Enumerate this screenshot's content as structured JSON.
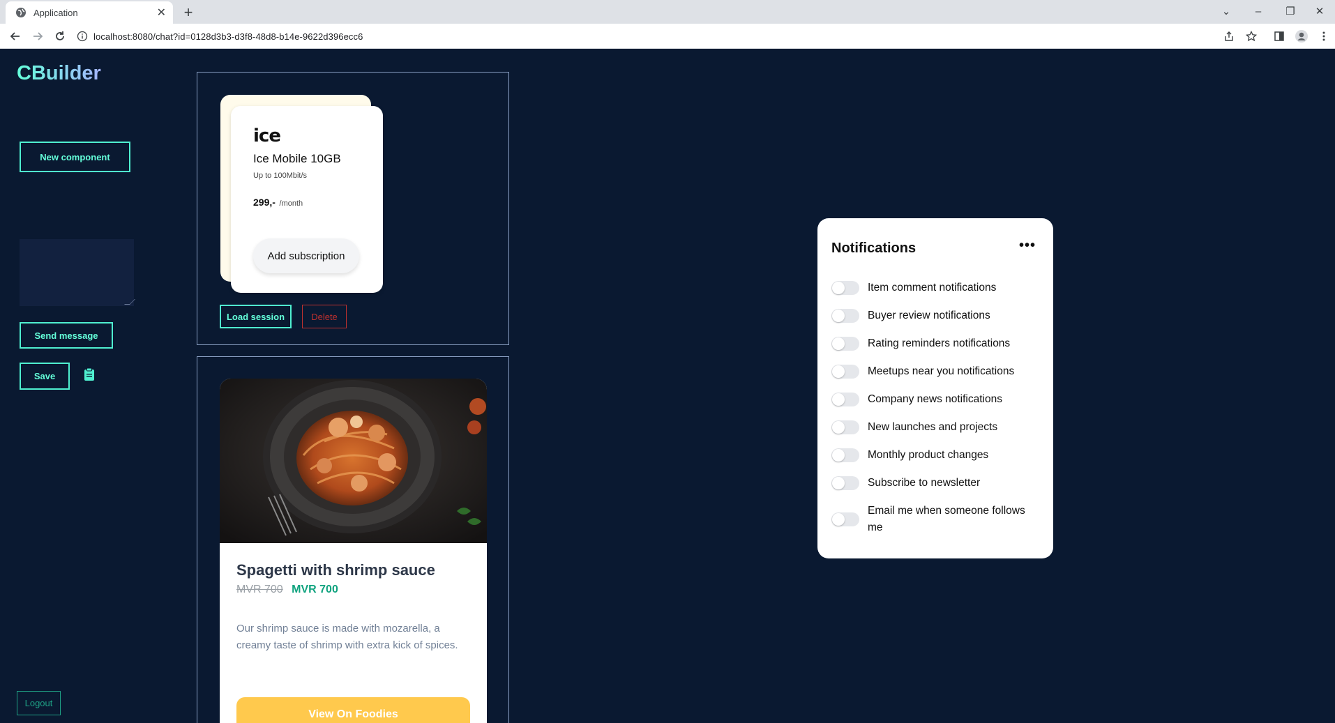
{
  "browser": {
    "tab_title": "Application",
    "url": "localhost:8080/chat?id=0128d3b3-d3f8-48d8-b14e-9622d396ecc6"
  },
  "sidebar": {
    "brand": "CBuilder",
    "new_component": "New component",
    "message_value": "",
    "send_message": "Send message",
    "save": "Save",
    "logout": "Logout"
  },
  "session1": {
    "card": {
      "logo": "ice",
      "plan_name": "Ice Mobile 10GB",
      "plan_speed": "Up to 100Mbit/s",
      "price": "299,-",
      "per": "/month",
      "add_button": "Add subscription"
    },
    "load_session": "Load session",
    "delete": "Delete"
  },
  "session2": {
    "title": "Spagetti with shrimp sauce",
    "old_price": "MVR 700",
    "new_price": "MVR 700",
    "description": "Our shrimp sauce is made with mozarella, a creamy taste of shrimp with extra kick of spices.",
    "button": "View On Foodies"
  },
  "notifications": {
    "title": "Notifications",
    "items": [
      {
        "label": "Item comment notifications",
        "on": false
      },
      {
        "label": "Buyer review notifications",
        "on": false
      },
      {
        "label": "Rating reminders notifications",
        "on": false
      },
      {
        "label": "Meetups near you notifications",
        "on": false
      },
      {
        "label": "Company news notifications",
        "on": false
      },
      {
        "label": "New launches and projects",
        "on": false
      },
      {
        "label": "Monthly product changes",
        "on": false
      },
      {
        "label": "Subscribe to newsletter",
        "on": false
      },
      {
        "label": "Email me when someone follows me",
        "on": false
      }
    ]
  },
  "colors": {
    "background": "#0a1931",
    "accent": "#64ffda",
    "danger": "#c0312f",
    "price_green": "#10a37f",
    "food_button": "#ffc94d"
  }
}
